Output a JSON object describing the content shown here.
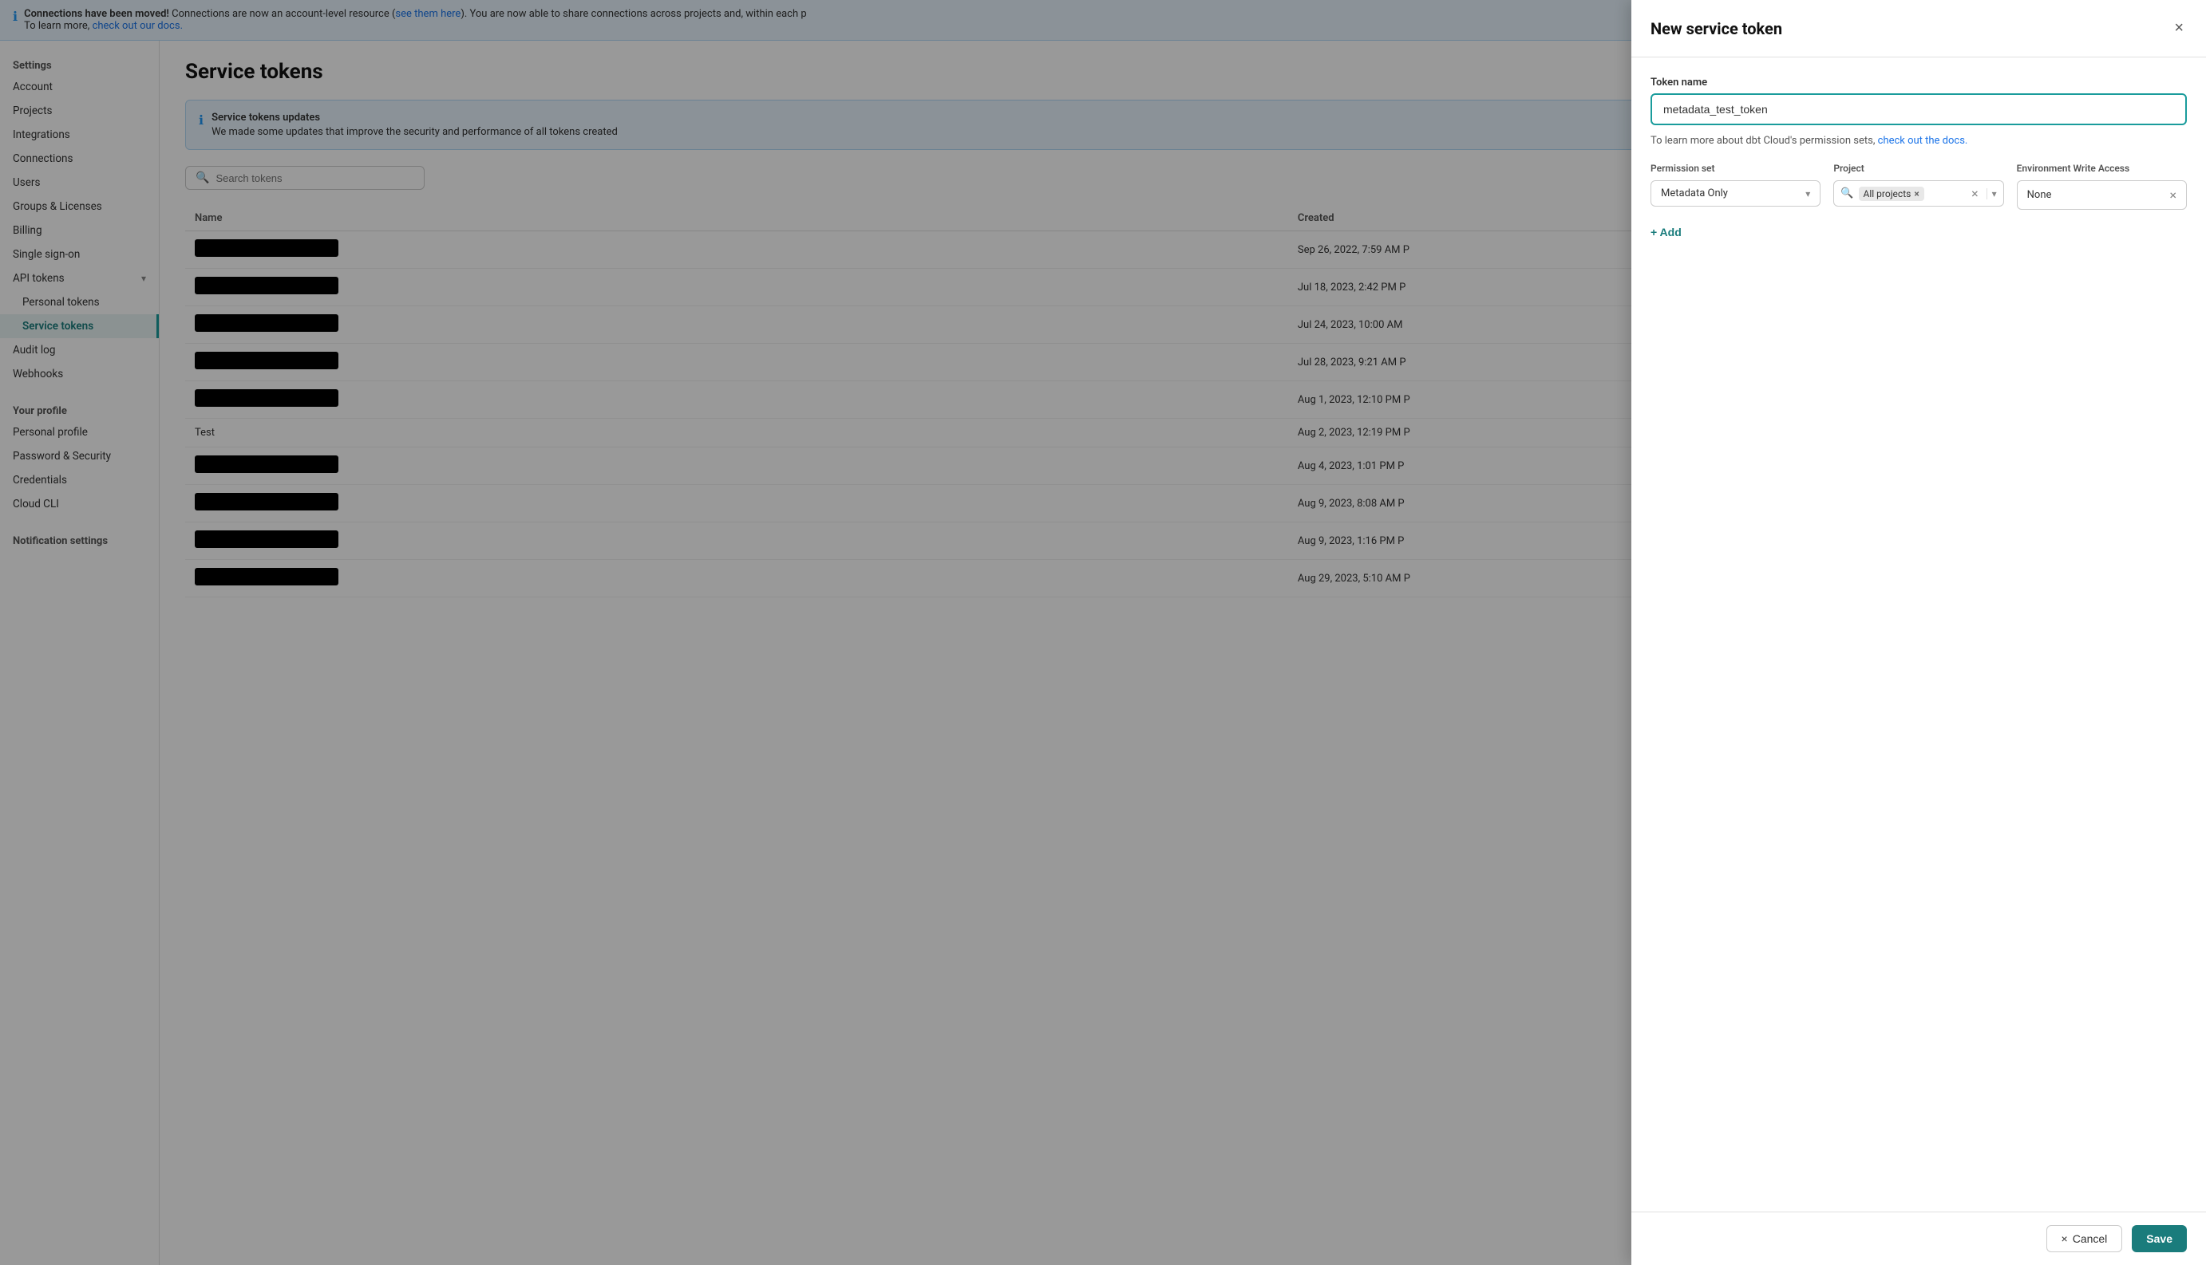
{
  "banner": {
    "icon": "ℹ",
    "title": "Connections have been moved!",
    "text1": "Connections are now an account-level resource (",
    "link1_text": "see them here",
    "text2": "). You are now able to share connections across projects and, within each p",
    "text3": "To learn more, ",
    "link2_text": "check out our docs.",
    "text4": ""
  },
  "sidebar": {
    "section1_title": "Settings",
    "items": [
      {
        "label": "Account",
        "active": false,
        "sub": false,
        "has_chevron": false
      },
      {
        "label": "Projects",
        "active": false,
        "sub": false,
        "has_chevron": false
      },
      {
        "label": "Integrations",
        "active": false,
        "sub": false,
        "has_chevron": false
      },
      {
        "label": "Connections",
        "active": false,
        "sub": false,
        "has_chevron": false
      },
      {
        "label": "Users",
        "active": false,
        "sub": false,
        "has_chevron": false
      },
      {
        "label": "Groups & Licenses",
        "active": false,
        "sub": false,
        "has_chevron": false
      },
      {
        "label": "Billing",
        "active": false,
        "sub": false,
        "has_chevron": false
      },
      {
        "label": "Single sign-on",
        "active": false,
        "sub": false,
        "has_chevron": false
      },
      {
        "label": "API tokens",
        "active": false,
        "sub": false,
        "has_chevron": true
      },
      {
        "label": "Personal tokens",
        "active": false,
        "sub": true,
        "has_chevron": false
      },
      {
        "label": "Service tokens",
        "active": true,
        "sub": true,
        "has_chevron": false
      },
      {
        "label": "Audit log",
        "active": false,
        "sub": false,
        "has_chevron": false
      },
      {
        "label": "Webhooks",
        "active": false,
        "sub": false,
        "has_chevron": false
      }
    ],
    "section2_title": "Your profile",
    "profile_items": [
      {
        "label": "Personal profile",
        "active": false
      },
      {
        "label": "Password & Security",
        "active": false
      },
      {
        "label": "Credentials",
        "active": false
      },
      {
        "label": "Cloud CLI",
        "active": false
      }
    ],
    "section3_title": "Notification settings"
  },
  "page": {
    "title": "Service tokens"
  },
  "info_box": {
    "icon": "ℹ",
    "title": "Service tokens updates",
    "text": "We made some updates that improve the security and performance of all tokens created"
  },
  "search": {
    "placeholder": "Search tokens",
    "icon": "🔍"
  },
  "table": {
    "columns": [
      "Name",
      "Created"
    ],
    "rows": [
      {
        "name": "REDACTED",
        "created": "Sep 26, 2022, 7:59 AM P"
      },
      {
        "name": "REDACTED",
        "created": "Jul 18, 2023, 2:42 PM P"
      },
      {
        "name": "REDACTED",
        "created": "Jul 24, 2023, 10:00 AM"
      },
      {
        "name": "REDACTED",
        "created": "Jul 28, 2023, 9:21 AM P"
      },
      {
        "name": "REDACTED",
        "created": "Aug 1, 2023, 12:10 PM P"
      },
      {
        "name": "Test",
        "created": "Aug 2, 2023, 12:19 PM P"
      },
      {
        "name": "REDACTED",
        "created": "Aug 4, 2023, 1:01 PM P"
      },
      {
        "name": "REDACTED",
        "created": "Aug 9, 2023, 8:08 AM P"
      },
      {
        "name": "REDACTED",
        "created": "Aug 9, 2023, 1:16 PM P"
      },
      {
        "name": "REDACTED",
        "created": "Aug 29, 2023, 5:10 AM P"
      }
    ]
  },
  "modal": {
    "title": "New service token",
    "close_label": "×",
    "token_name_label": "Token name",
    "token_name_value": "metadata_test_token",
    "hint_text": "To learn more about dbt Cloud's permission sets, ",
    "hint_link": "check out the docs.",
    "permission_set_label": "Permission set",
    "permission_set_value": "Metadata Only",
    "project_label": "Project",
    "project_tag": "All projects",
    "env_write_label": "Environment Write Access",
    "env_write_value": "None",
    "add_label": "+ Add",
    "cancel_label": "Cancel",
    "save_label": "Save"
  }
}
